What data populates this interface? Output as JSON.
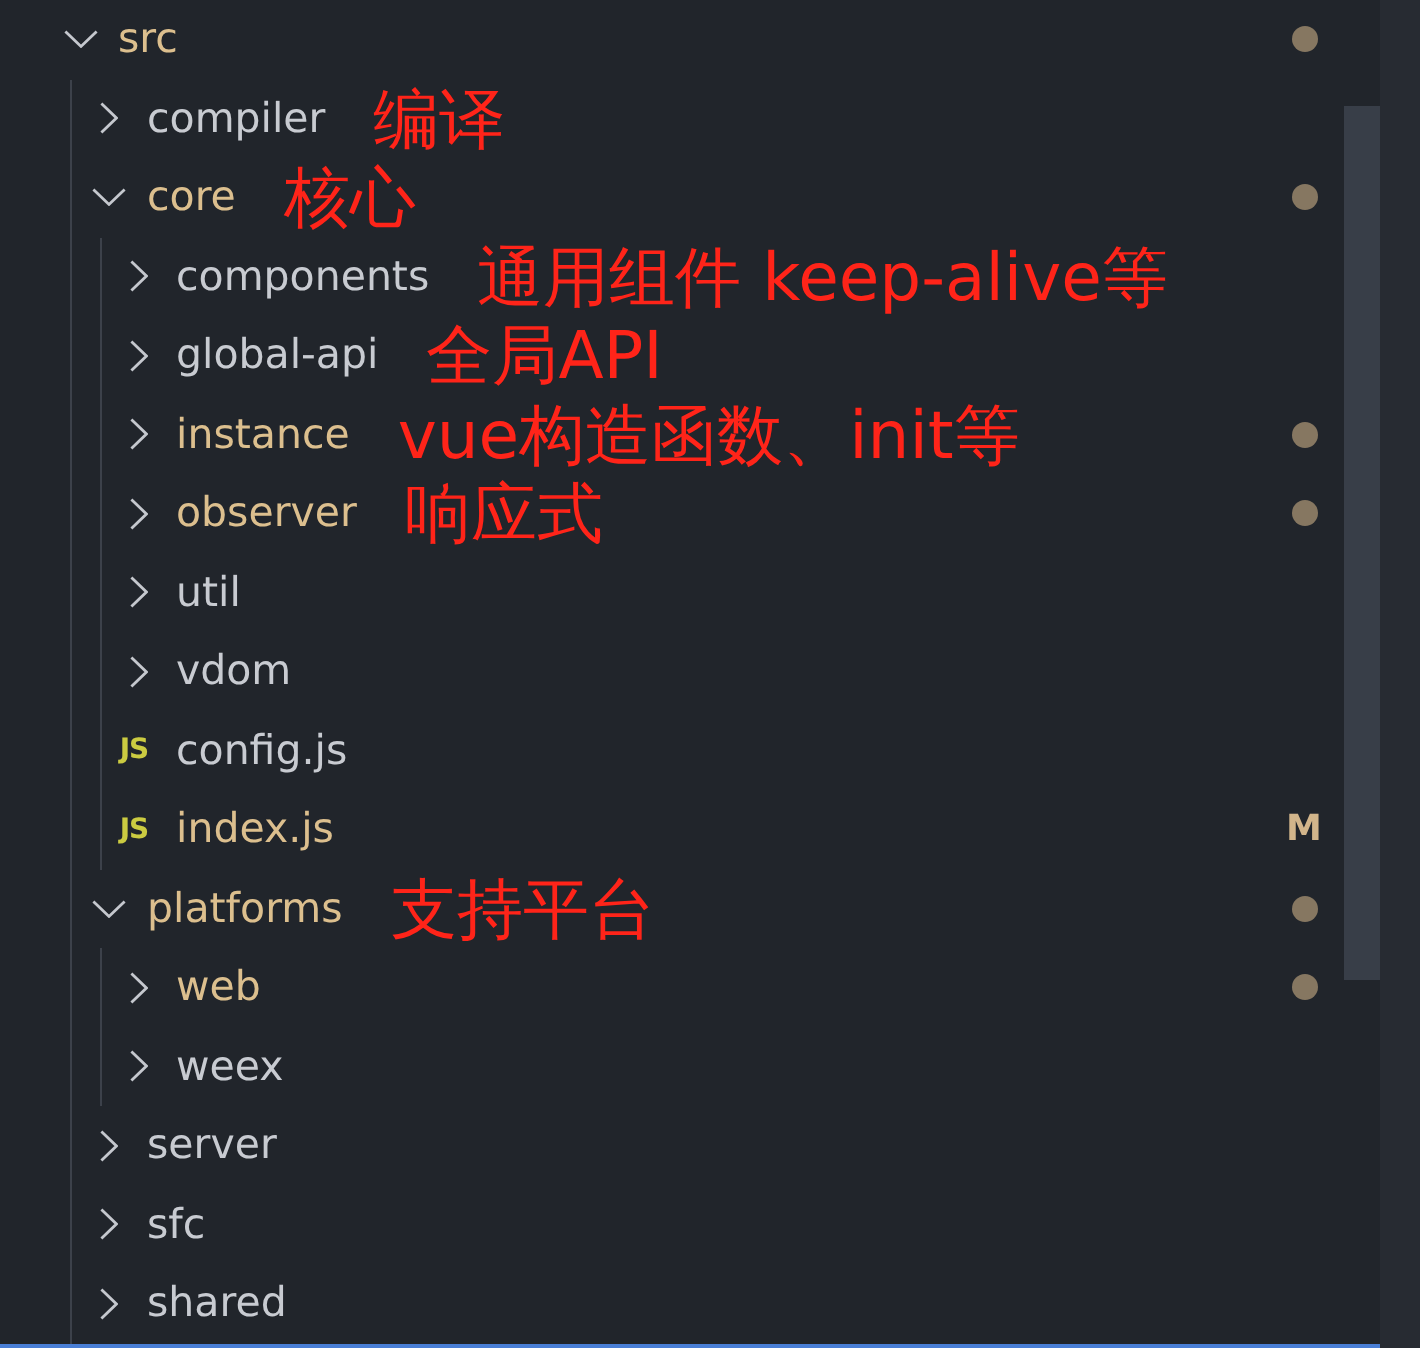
{
  "explorer": {
    "tree": [
      {
        "kind": "folder",
        "name": "src",
        "expanded": true,
        "modified": true,
        "children": [
          {
            "kind": "folder",
            "name": "compiler",
            "expanded": false,
            "modified": false,
            "note": "编译"
          },
          {
            "kind": "folder",
            "name": "core",
            "expanded": true,
            "modified": true,
            "note": "核心",
            "children": [
              {
                "kind": "folder",
                "name": "components",
                "expanded": false,
                "modified": false,
                "note": "通用组件 keep-alive等"
              },
              {
                "kind": "folder",
                "name": "global-api",
                "expanded": false,
                "modified": false,
                "note": "全局API"
              },
              {
                "kind": "folder",
                "name": "instance",
                "expanded": false,
                "modified": true,
                "note": "vue构造函数、init等"
              },
              {
                "kind": "folder",
                "name": "observer",
                "expanded": false,
                "modified": true,
                "note": "响应式"
              },
              {
                "kind": "folder",
                "name": "util",
                "expanded": false,
                "modified": false
              },
              {
                "kind": "folder",
                "name": "vdom",
                "expanded": false,
                "modified": false
              },
              {
                "kind": "file",
                "name": "config.js",
                "icon": "JS",
                "modified": false
              },
              {
                "kind": "file",
                "name": "index.js",
                "icon": "JS",
                "modified": true,
                "badge": "M"
              }
            ]
          },
          {
            "kind": "folder",
            "name": "platforms",
            "expanded": true,
            "modified": true,
            "note": "支持平台",
            "children": [
              {
                "kind": "folder",
                "name": "web",
                "expanded": false,
                "modified": true
              },
              {
                "kind": "folder",
                "name": "weex",
                "expanded": false,
                "modified": false
              }
            ]
          },
          {
            "kind": "folder",
            "name": "server",
            "expanded": false,
            "modified": false
          },
          {
            "kind": "folder",
            "name": "sfc",
            "expanded": false,
            "modified": false
          },
          {
            "kind": "folder",
            "name": "shared",
            "expanded": false,
            "modified": false
          }
        ]
      }
    ]
  }
}
